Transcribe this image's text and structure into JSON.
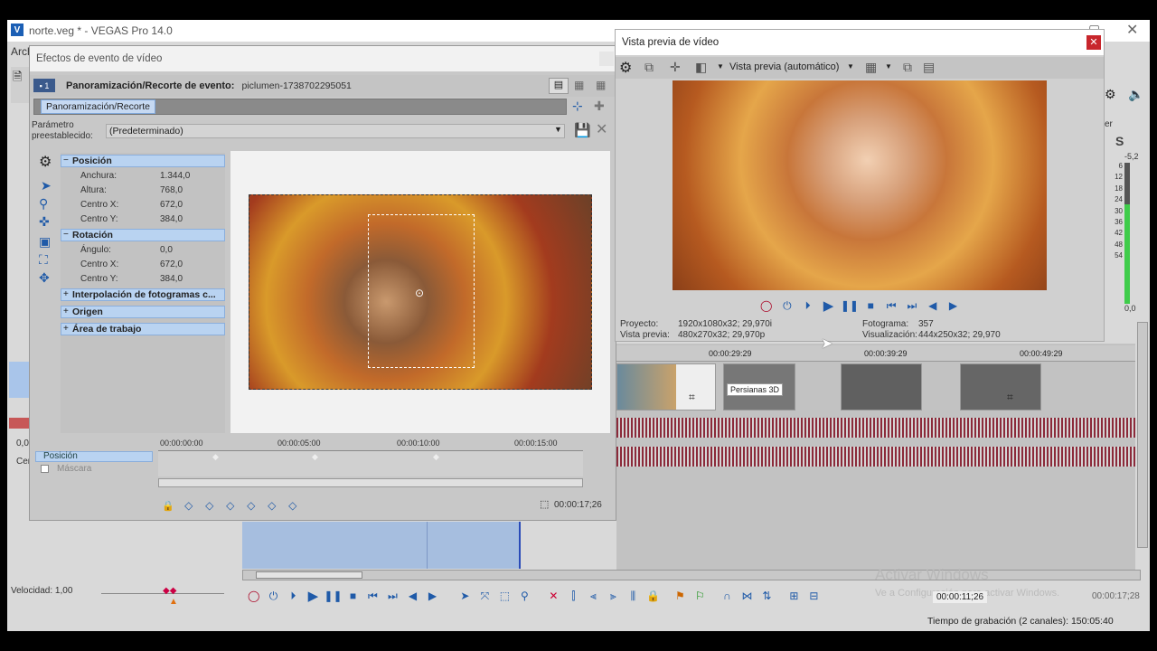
{
  "main": {
    "title": "norte.veg * - VEGAS Pro 14.0",
    "menu_first": "Arch"
  },
  "effect_dialog": {
    "title": "Efectos de evento de vídeo",
    "header_label": "Panoramización/Recorte de evento:",
    "header_value": "piclumen-1738702295051",
    "chain_chip": "Panoramización/Recorte",
    "preset_label": "Parámetro preestablecido:",
    "preset_value": "(Predeterminado)",
    "sections": [
      {
        "title": "Posición",
        "rows": [
          {
            "k": "Anchura:",
            "v": "1.344,0"
          },
          {
            "k": "Altura:",
            "v": "768,0"
          },
          {
            "k": "Centro X:",
            "v": "672,0"
          },
          {
            "k": "Centro Y:",
            "v": "384,0"
          }
        ]
      },
      {
        "title": "Rotación",
        "rows": [
          {
            "k": "Ángulo:",
            "v": "0,0"
          },
          {
            "k": "Centro X:",
            "v": "672,0"
          },
          {
            "k": "Centro Y:",
            "v": "384,0"
          }
        ]
      }
    ],
    "collapsed_sections": [
      "Interpolación de fotogramas c...",
      "Origen",
      "Área de trabajo"
    ],
    "track_labels": [
      "Posición",
      "Máscara"
    ],
    "ruler_times": [
      "00:00:00:00",
      "00:00:05:00",
      "00:00:10:00",
      "00:00:15:00"
    ],
    "current_time": "00:00:17;26"
  },
  "preview": {
    "title": "Vista previa de vídeo",
    "mode": "Vista previa (automático)",
    "project_label": "Proyecto:",
    "project_value": "1920x1080x32; 29,970i",
    "preview_label": "Vista previa:",
    "preview_value": "480x270x32; 29,970p",
    "frame_label": "Fotograma:",
    "frame_value": "357",
    "display_label": "Visualización:",
    "display_value": "444x250x32; 29,970"
  },
  "timeline": {
    "ruler": [
      "00:00:29:29",
      "00:00:39:29",
      "00:00:49:29"
    ],
    "transition_label": "Persianas 3D"
  },
  "left": {
    "speed": "Velocidad: 1,00",
    "small_value": "0,0",
    "cen": "Cen"
  },
  "transport": {
    "time1": "00:00:11;26",
    "time2": "00:00:17;28"
  },
  "meter": {
    "label": "S",
    "top": "-5,2",
    "values": [
      "6",
      "12",
      "18",
      "24",
      "30",
      "36",
      "42",
      "48",
      "54"
    ],
    "bottom": "0,0",
    "er": "er"
  },
  "status": {
    "recording": "Tiempo de grabación (2 canales): 150:05:40"
  },
  "watermark": {
    "line1": "Activar Windows",
    "line2": "Ve a Configuración para activar Windows."
  },
  "colors": {
    "accent": "#1f5aa8",
    "selection": "#b9d3f1",
    "close": "#c8262c",
    "waveform": "#8b2a3a",
    "meter_green": "#3fcc4a"
  }
}
